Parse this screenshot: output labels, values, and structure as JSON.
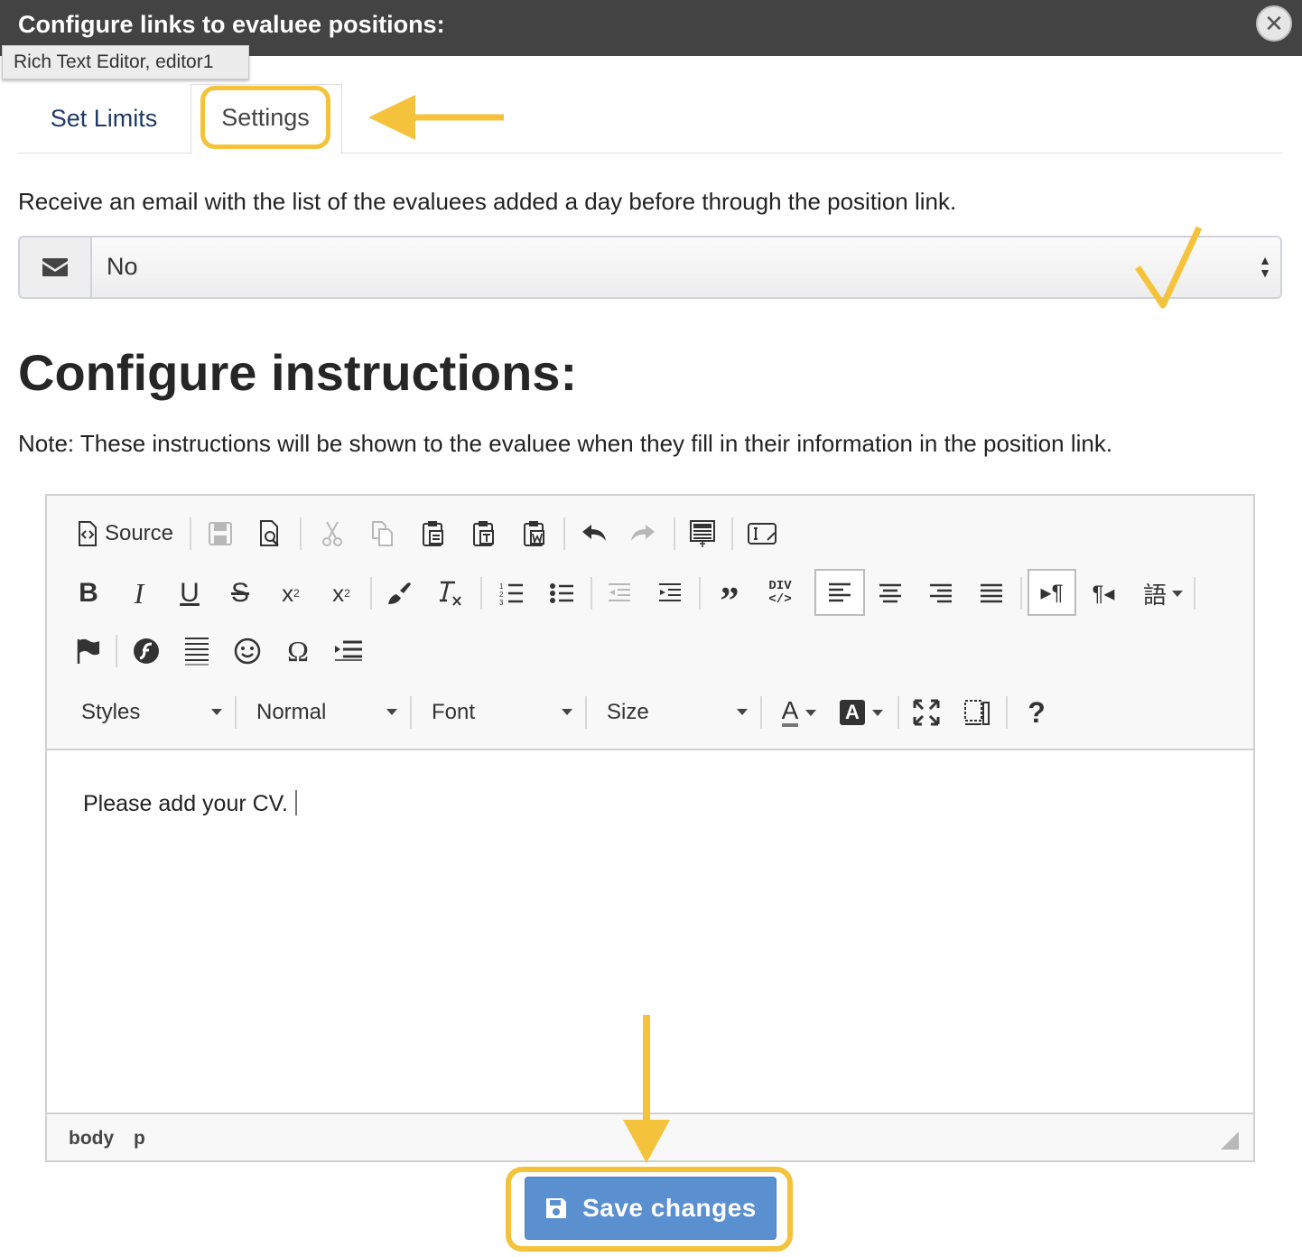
{
  "header": {
    "title": "Configure links to evaluee positions:",
    "tooltip": "Rich Text Editor, editor1"
  },
  "tabs": [
    {
      "label": "Set Limits"
    },
    {
      "label": "Settings"
    }
  ],
  "settings": {
    "label": "Receive an email with the list of the evaluees added a day before through the position link.",
    "email_select_value": "No"
  },
  "instructions": {
    "heading": "Configure instructions:",
    "note": "Note: These instructions will be shown to the evaluee when they fill in their information in the position link."
  },
  "editor": {
    "toolbar": {
      "source_label": "Source",
      "strike_glyph": "S",
      "sub_glyph": "x",
      "sub_script": "2",
      "sup_glyph": "x",
      "sup_script": "2",
      "div_glyph": "DIV",
      "styles_label": "Styles",
      "format_label": "Normal",
      "font_label": "Font",
      "size_label": "Size",
      "text_color_glyph": "A",
      "bg_color_glyph": "A",
      "help_glyph": "?"
    },
    "content_text": "Please add your CV.",
    "path": [
      "body",
      "p"
    ]
  },
  "save_button": {
    "label": "Save changes"
  },
  "colors": {
    "header_bg": "#434343",
    "highlight": "#f5c33b",
    "primary": "#5a8fd0"
  }
}
